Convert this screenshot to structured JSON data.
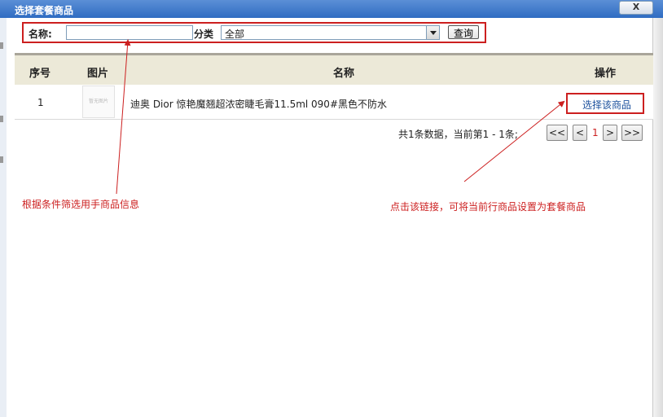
{
  "window": {
    "title": "选择套餐商品",
    "close_label": "X"
  },
  "search": {
    "name_label": "名称:",
    "name_value": "",
    "category_label": "分类",
    "category_selected": "全部",
    "query_label": "查询"
  },
  "table": {
    "headers": {
      "index": "序号",
      "image": "图片",
      "name": "名称",
      "action": "操作"
    },
    "rows": [
      {
        "index": "1",
        "image_text": "暂无图片",
        "name": "迪奥 Dior 惊艳魔翘超浓密睫毛膏11.5ml 090#黑色不防水",
        "action": "选择该商品"
      }
    ]
  },
  "pagination": {
    "summary": "共1条数据，当前第1 - 1条;",
    "first": "<<",
    "prev": "<",
    "current": "1",
    "next": ">",
    "last": ">>"
  },
  "annotations": {
    "filter_note": "根据条件筛选用手商品信息",
    "link_note": "点击该链接，可将当前行商品设置为套餐商品"
  },
  "colors": {
    "annotation": "#cc1f1f",
    "link": "#1a4f9c",
    "header_bg": "#ece9d8",
    "titlebar": "#2f6cc2"
  }
}
